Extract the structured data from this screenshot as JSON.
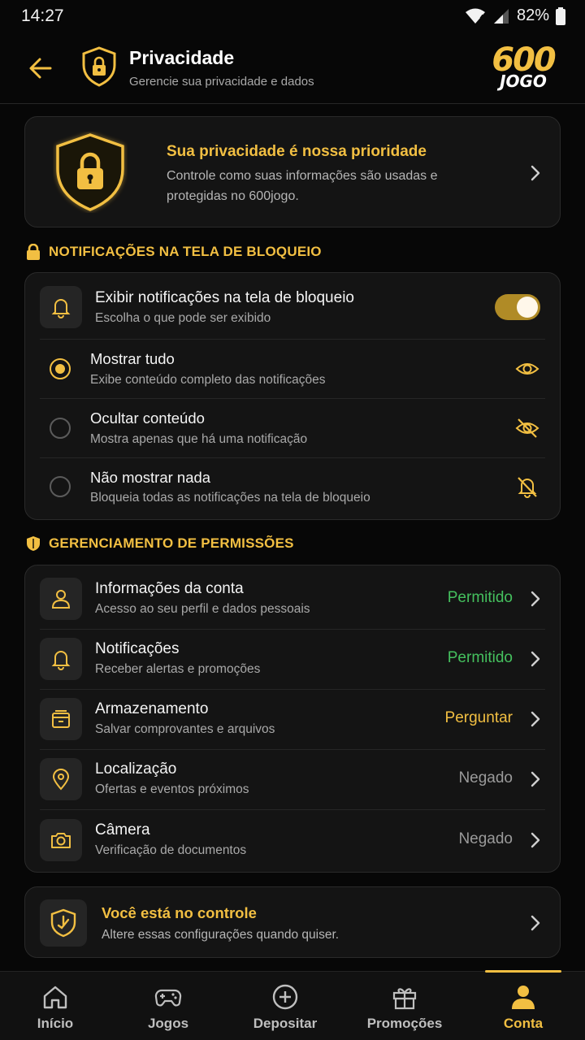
{
  "status_bar": {
    "time": "14:27",
    "battery": "82%"
  },
  "header": {
    "title": "Privacidade",
    "subtitle": "Gerencie sua privacidade e dados",
    "logo_top": "600",
    "logo_bottom": "JOGO"
  },
  "hero": {
    "title": "Sua privacidade é nossa prioridade",
    "description": "Controle como suas informações são usadas e protegidas no 600jogo."
  },
  "lockscreen": {
    "section_title": "NOTIFICAÇÕES NA TELA DE BLOQUEIO",
    "toggle_title": "Exibir notificações na tela de bloqueio",
    "toggle_desc": "Escolha o que pode ser exibido",
    "toggle_on": true,
    "options": [
      {
        "label": "Mostrar tudo",
        "desc": "Exibe conteúdo completo das notificações",
        "selected": true,
        "icon": "eye-icon"
      },
      {
        "label": "Ocultar conteúdo",
        "desc": "Mostra apenas que há uma notificação",
        "selected": false,
        "icon": "eye-off-icon"
      },
      {
        "label": "Não mostrar nada",
        "desc": "Bloqueia todas as notificações na tela de bloqueio",
        "selected": false,
        "icon": "bell-off-icon"
      }
    ]
  },
  "permissions": {
    "section_title": "GERENCIAMENTO DE PERMISSÕES",
    "items": [
      {
        "title": "Informações da conta",
        "desc": "Acesso ao seu perfil e dados pessoais",
        "status": "Permitido",
        "status_color": "#45c05e",
        "icon": "user-icon"
      },
      {
        "title": "Notificações",
        "desc": "Receber alertas e promoções",
        "status": "Permitido",
        "status_color": "#45c05e",
        "icon": "bell-icon"
      },
      {
        "title": "Armazenamento",
        "desc": "Salvar comprovantes e arquivos",
        "status": "Perguntar",
        "status_color": "#f2bf42",
        "icon": "archive-icon"
      },
      {
        "title": "Localização",
        "desc": "Ofertas e eventos próximos",
        "status": "Negado",
        "status_color": "#9a9a9a",
        "icon": "location-pin-icon"
      },
      {
        "title": "Câmera",
        "desc": "Verificação de documentos",
        "status": "Negado",
        "status_color": "#9a9a9a",
        "icon": "camera-icon"
      }
    ]
  },
  "control": {
    "title": "Você está no controle",
    "desc": "Altere essas configurações quando quiser."
  },
  "bottom_nav": {
    "items": [
      {
        "label": "Início",
        "icon": "home-icon"
      },
      {
        "label": "Jogos",
        "icon": "gamepad-icon"
      },
      {
        "label": "Depositar",
        "icon": "plus-circle-icon"
      },
      {
        "label": "Promoções",
        "icon": "gift-icon"
      },
      {
        "label": "Conta",
        "icon": "person-icon"
      }
    ],
    "active": "Conta"
  },
  "colors": {
    "accent": "#f2bf42",
    "allowed": "#45c05e",
    "denied": "#9a9a9a",
    "background": "#070707",
    "card": "#141414"
  }
}
